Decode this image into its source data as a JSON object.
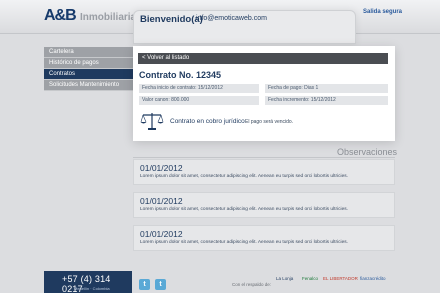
{
  "header": {
    "logo_text": "A&B",
    "brand_sub": "Inmobiliaria",
    "welcome": "Bienvenido(a)",
    "email": "info@emoticaweb.com",
    "logout": "Salida segura"
  },
  "sidebar": {
    "items": [
      {
        "label": "Cartelera",
        "active": false
      },
      {
        "label": "Histórico de pagos",
        "active": false
      },
      {
        "label": "Contratos",
        "active": true
      },
      {
        "label": "Solicitudes Mantenimiento",
        "active": false
      }
    ]
  },
  "contract": {
    "back_label": "< Volver al listado",
    "title": "Contrato No. 12345",
    "start_date": "Fecha inicio de contrato: 15/12/2012",
    "payment_date": "Fecha de pago: Dias 1",
    "value": "Valor canon: 800.000",
    "increase_date": "Fecha incremento: 15/12/2012",
    "status": "Contrato en cobro jurídico",
    "status_note": "El pago será vencido."
  },
  "observations": {
    "title": "Observaciones",
    "items": [
      {
        "date": "01/01/2012",
        "text": "Lorem ipsum dolor sit amet, consectetur adipiscing elit. Aenean eu turpis sed orci lobortis ultricies."
      },
      {
        "date": "01/01/2012",
        "text": "Lorem ipsum dolor sit amet, consectetur adipiscing elit. Aenean eu turpis sed orci lobortis ultricies."
      },
      {
        "date": "01/01/2012",
        "text": "Lorem ipsum dolor sit amet, consectetur adipiscing elit. Aenean eu turpis sed orci lobortis ultricies."
      }
    ]
  },
  "footer": {
    "phone": "+57 (4) 314 0217",
    "city": "Medellín · Colombia",
    "backed_by": "Con el respaldo de:",
    "partners": [
      "La Lonja",
      "Fenalco",
      "EL LIBERTADOR",
      "fianzacrédito"
    ]
  },
  "colors": {
    "primary": "#1f3a5f",
    "sidebar_bg": "#9ea1a6",
    "page_bg": "#dcdde0"
  }
}
